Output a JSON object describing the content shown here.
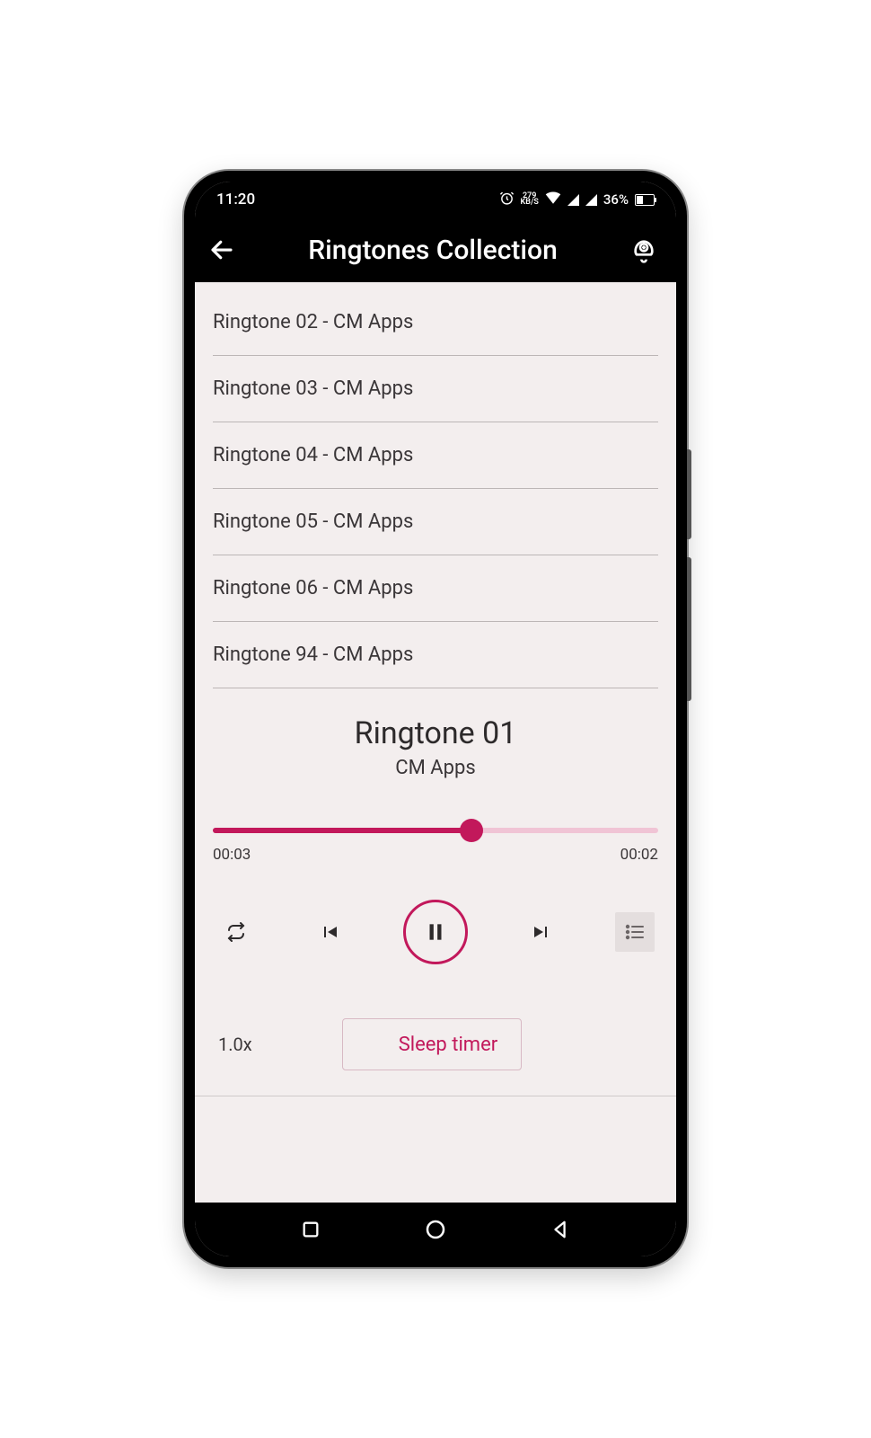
{
  "status": {
    "time": "11:20",
    "net_speed_top": "279",
    "net_speed_bottom": "KB/S",
    "battery_pct": "36%"
  },
  "header": {
    "title": "Ringtones Collection"
  },
  "list": {
    "items": [
      "Ringtone 02 - CM Apps",
      "Ringtone 03 - CM Apps",
      "Ringtone 04 - CM Apps",
      "Ringtone 05 - CM Apps",
      "Ringtone 06 - CM Apps",
      "Ringtone 94 - CM Apps"
    ]
  },
  "player": {
    "title": "Ringtone 01",
    "artist": "CM Apps",
    "elapsed": "00:03",
    "remaining": "00:02",
    "progress_pct": 58,
    "speed": "1.0x",
    "sleep_label": "Sleep timer"
  },
  "colors": {
    "accent": "#c2185b"
  }
}
